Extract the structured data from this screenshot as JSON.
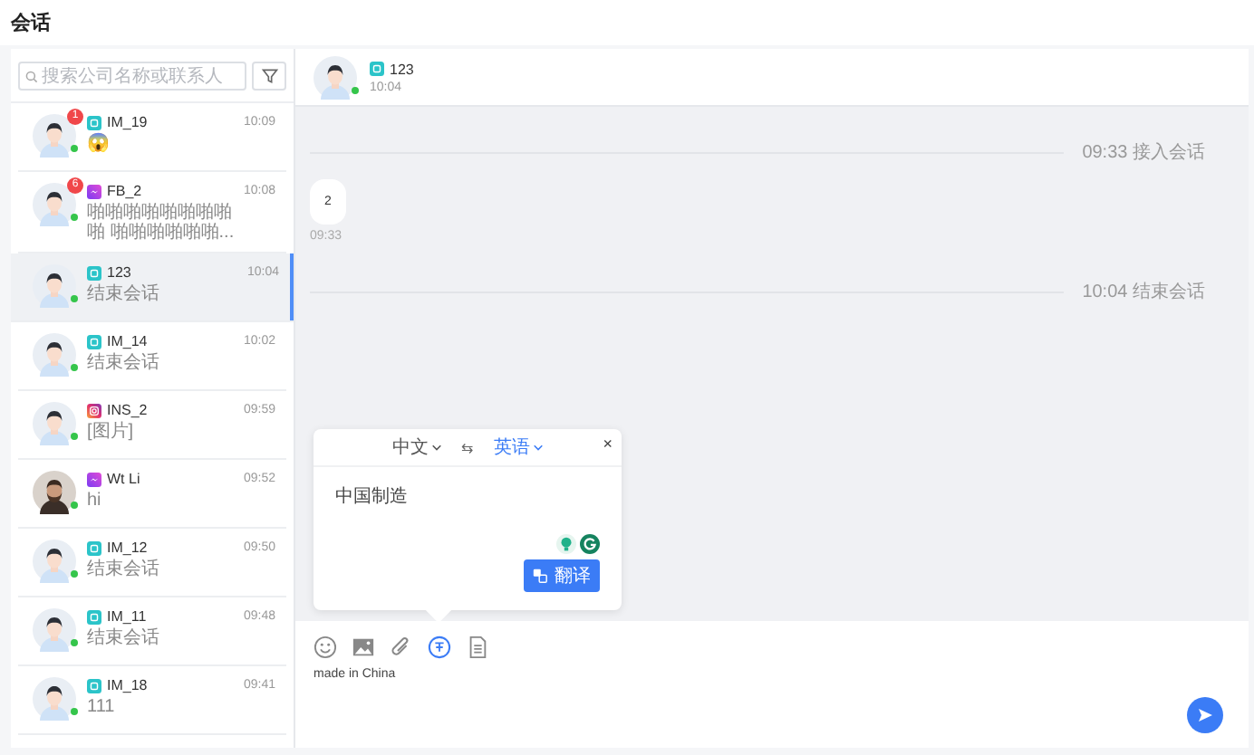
{
  "page": {
    "title": "会话"
  },
  "search": {
    "placeholder": "搜索公司名称或联系人"
  },
  "conversations": [
    {
      "name": "IM_19",
      "channel": {
        "kind": "im"
      },
      "avatar": {
        "kind": "default"
      },
      "online": true,
      "unread": "1",
      "time": "10:09",
      "preview": "😱",
      "selected": false
    },
    {
      "name": "FB_2",
      "channel": {
        "kind": "fb"
      },
      "avatar": {
        "kind": "default"
      },
      "online": true,
      "unread": "6",
      "time": "10:08",
      "preview": "啪啪啪啪啪啪啪啪啪 啪啪啪啪啪啪...",
      "selected": false
    },
    {
      "name": "123",
      "channel": {
        "kind": "im"
      },
      "avatar": {
        "kind": "default"
      },
      "online": true,
      "time": "10:04",
      "preview": "结束会话",
      "selected": true
    },
    {
      "name": "IM_14",
      "channel": {
        "kind": "im"
      },
      "avatar": {
        "kind": "default"
      },
      "online": true,
      "time": "10:02",
      "preview": "结束会话",
      "selected": false
    },
    {
      "name": "INS_2",
      "channel": {
        "kind": "ins"
      },
      "avatar": {
        "kind": "default"
      },
      "online": true,
      "time": "09:59",
      "preview": "[图片]",
      "selected": false
    },
    {
      "name": "Wt Li",
      "channel": {
        "kind": "fb"
      },
      "avatar": {
        "kind": "photo"
      },
      "online": true,
      "time": "09:52",
      "preview": "hi",
      "selected": false
    },
    {
      "name": "IM_12",
      "channel": {
        "kind": "im"
      },
      "avatar": {
        "kind": "default"
      },
      "online": true,
      "time": "09:50",
      "preview": "结束会话",
      "selected": false
    },
    {
      "name": "IM_11",
      "channel": {
        "kind": "im"
      },
      "avatar": {
        "kind": "default"
      },
      "online": true,
      "time": "09:48",
      "preview": "结束会话",
      "selected": false
    },
    {
      "name": "IM_18",
      "channel": {
        "kind": "im"
      },
      "avatar": {
        "kind": "default"
      },
      "online": true,
      "time": "09:41",
      "preview": "111",
      "selected": false
    }
  ],
  "chat": {
    "name": "123",
    "channel": {
      "kind": "im"
    },
    "avatar": {
      "kind": "default"
    },
    "online": true,
    "time": "10:04",
    "messages": [
      {
        "kind": "event",
        "text": "09:33 接入会话"
      },
      {
        "kind": "bubble",
        "text": "2",
        "time": "09:33"
      },
      {
        "kind": "event",
        "text": "10:04 结束会话"
      }
    ]
  },
  "translator": {
    "source": "中文",
    "swap": "⇆",
    "target": "英语",
    "close": "×",
    "text": "中国制造",
    "button": "翻译"
  },
  "composer": {
    "tools": [
      {
        "kind": "emoji",
        "active": false
      },
      {
        "kind": "image",
        "active": false
      },
      {
        "kind": "attachment",
        "active": false
      },
      {
        "kind": "translate",
        "active": true
      },
      {
        "kind": "document",
        "active": false
      }
    ],
    "value": "made in China"
  }
}
